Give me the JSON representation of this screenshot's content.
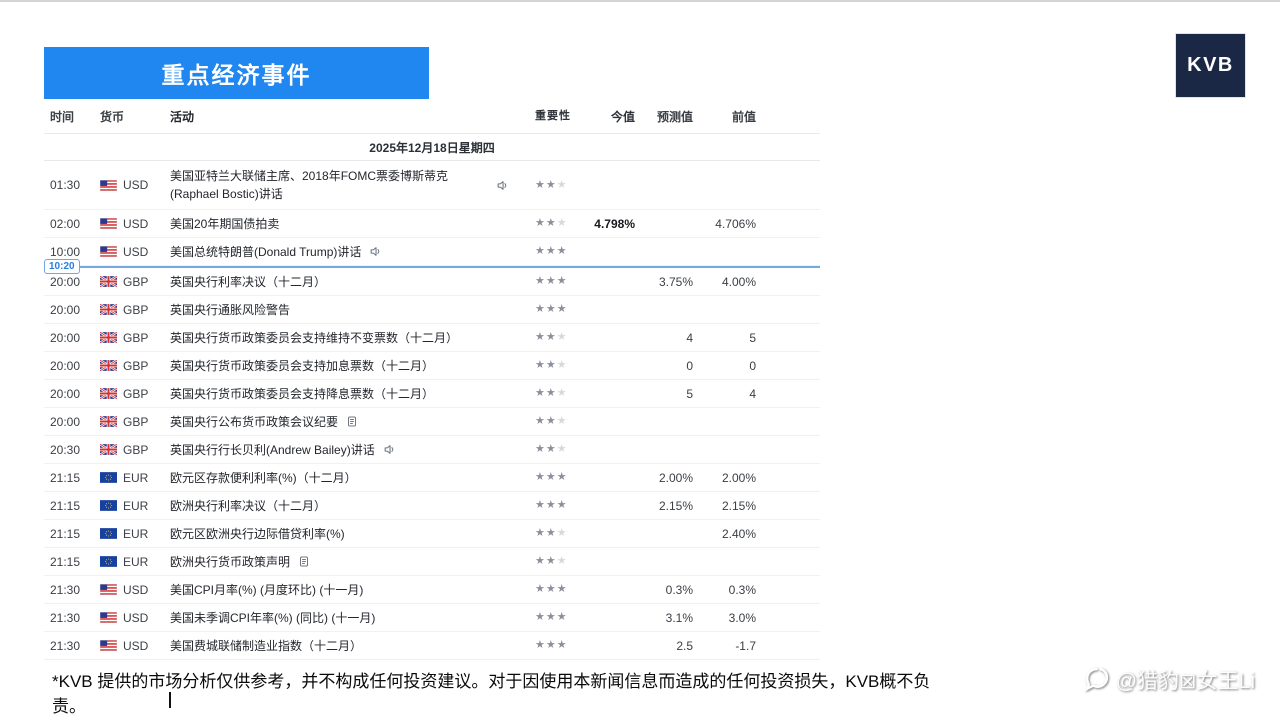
{
  "page": {
    "banner_title": "重点经济事件",
    "logo_text": "KVB",
    "disclaimer": "*KVB 提供的市场分析仅供参考，并不构成任何投资建议。对于因使用本新闻信息而造成的任何投资损失，KVB概不负责。",
    "watermark_text": "@猎豹⊠女王Li"
  },
  "colors": {
    "banner_blue": "#2086f0",
    "marker_blue": "#74a9e6",
    "logo_navy": "#1a2845",
    "star_filled": "#8a909a",
    "star_empty": "#d6d9de"
  },
  "table": {
    "headers": {
      "time": "时间",
      "currency": "货币",
      "activity": "活动",
      "importance": "重要性",
      "actual": "今值",
      "forecast": "预测值",
      "previous": "前值"
    },
    "date_header": "2025年12月18日星期四",
    "time_marker": {
      "label": "10:20"
    },
    "rows": [
      {
        "time": "01:30",
        "currency": "USD",
        "flag": "us",
        "activity": "美国亚特兰大联储主席、2018年FOMC票委博斯蒂克(Raphael Bostic)讲话",
        "icon": "speaker",
        "stars": 2,
        "actual": "",
        "forecast": "",
        "previous": "",
        "tall": true
      },
      {
        "time": "02:00",
        "currency": "USD",
        "flag": "us",
        "activity": "美国20年期国债拍卖",
        "icon": "",
        "stars": 2,
        "actual": "4.798%",
        "forecast": "",
        "previous": "4.706%"
      },
      {
        "time": "10:00",
        "currency": "USD",
        "flag": "us",
        "activity": "美国总统特朗普(Donald Trump)讲话",
        "icon": "speaker",
        "stars": 3,
        "actual": "",
        "forecast": "",
        "previous": "",
        "marker_after": true
      },
      {
        "time": "20:00",
        "currency": "GBP",
        "flag": "gb",
        "activity": "英国央行利率决议（十二月）",
        "icon": "",
        "stars": 3,
        "actual": "",
        "forecast": "3.75%",
        "previous": "4.00%"
      },
      {
        "time": "20:00",
        "currency": "GBP",
        "flag": "gb",
        "activity": "英国央行通胀风险警告",
        "icon": "",
        "stars": 3,
        "actual": "",
        "forecast": "",
        "previous": ""
      },
      {
        "time": "20:00",
        "currency": "GBP",
        "flag": "gb",
        "activity": "英国央行货币政策委员会支持维持不变票数（十二月）",
        "icon": "",
        "stars": 2,
        "actual": "",
        "forecast": "4",
        "previous": "5"
      },
      {
        "time": "20:00",
        "currency": "GBP",
        "flag": "gb",
        "activity": "英国央行货币政策委员会支持加息票数（十二月）",
        "icon": "",
        "stars": 2,
        "actual": "",
        "forecast": "0",
        "previous": "0"
      },
      {
        "time": "20:00",
        "currency": "GBP",
        "flag": "gb",
        "activity": "英国央行货币政策委员会支持降息票数（十二月）",
        "icon": "",
        "stars": 2,
        "actual": "",
        "forecast": "5",
        "previous": "4"
      },
      {
        "time": "20:00",
        "currency": "GBP",
        "flag": "gb",
        "activity": "英国央行公布货币政策会议纪要",
        "icon": "document",
        "stars": 2,
        "actual": "",
        "forecast": "",
        "previous": ""
      },
      {
        "time": "20:30",
        "currency": "GBP",
        "flag": "gb",
        "activity": "英国央行行长贝利(Andrew Bailey)讲话",
        "icon": "speaker",
        "stars": 2,
        "actual": "",
        "forecast": "",
        "previous": ""
      },
      {
        "time": "21:15",
        "currency": "EUR",
        "flag": "eu",
        "activity": "欧元区存款便利利率(%)（十二月）",
        "icon": "",
        "stars": 3,
        "actual": "",
        "forecast": "2.00%",
        "previous": "2.00%"
      },
      {
        "time": "21:15",
        "currency": "EUR",
        "flag": "eu",
        "activity": "欧洲央行利率决议（十二月）",
        "icon": "",
        "stars": 3,
        "actual": "",
        "forecast": "2.15%",
        "previous": "2.15%"
      },
      {
        "time": "21:15",
        "currency": "EUR",
        "flag": "eu",
        "activity": "欧元区欧洲央行边际借贷利率(%)",
        "icon": "",
        "stars": 2,
        "actual": "",
        "forecast": "",
        "previous": "2.40%"
      },
      {
        "time": "21:15",
        "currency": "EUR",
        "flag": "eu",
        "activity": "欧洲央行货币政策声明",
        "icon": "document",
        "stars": 2,
        "actual": "",
        "forecast": "",
        "previous": ""
      },
      {
        "time": "21:30",
        "currency": "USD",
        "flag": "us",
        "activity": "美国CPI月率(%) (月度环比) (十一月)",
        "icon": "",
        "stars": 3,
        "actual": "",
        "forecast": "0.3%",
        "previous": "0.3%"
      },
      {
        "time": "21:30",
        "currency": "USD",
        "flag": "us",
        "activity": "美国未季调CPI年率(%) (同比) (十一月)",
        "icon": "",
        "stars": 3,
        "actual": "",
        "forecast": "3.1%",
        "previous": "3.0%"
      },
      {
        "time": "21:30",
        "currency": "USD",
        "flag": "us",
        "activity": "美国费城联储制造业指数（十二月）",
        "icon": "",
        "stars": 3,
        "actual": "",
        "forecast": "2.5",
        "previous": "-1.7"
      }
    ]
  }
}
